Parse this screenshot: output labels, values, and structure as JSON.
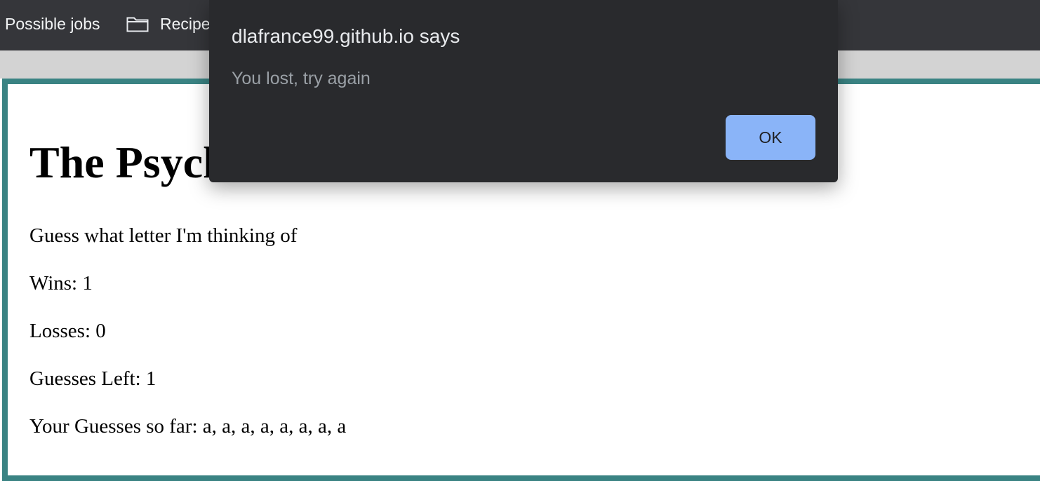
{
  "bookmarks_bar": {
    "items": [
      {
        "label": "Possible jobs",
        "icon": null
      },
      {
        "label": "Recipe",
        "icon": "folder-icon"
      }
    ]
  },
  "page": {
    "title": "The Psych",
    "instructions": "Guess what letter I'm thinking of",
    "wins": "Wins: 1",
    "losses": "Losses: 0",
    "guesses_left": "Guesses Left: 1",
    "guesses_so_far": "Your Guesses so far: a, a, a, a, a, a, a, a"
  },
  "dialog": {
    "title": "dlafrance99.github.io says",
    "message": "You lost, try again",
    "ok_label": "OK"
  },
  "colors": {
    "toolbar_bg": "#35363a",
    "frame_border": "#3a8383",
    "dialog_bg": "#292a2d",
    "ok_button": "#8ab4f8"
  }
}
